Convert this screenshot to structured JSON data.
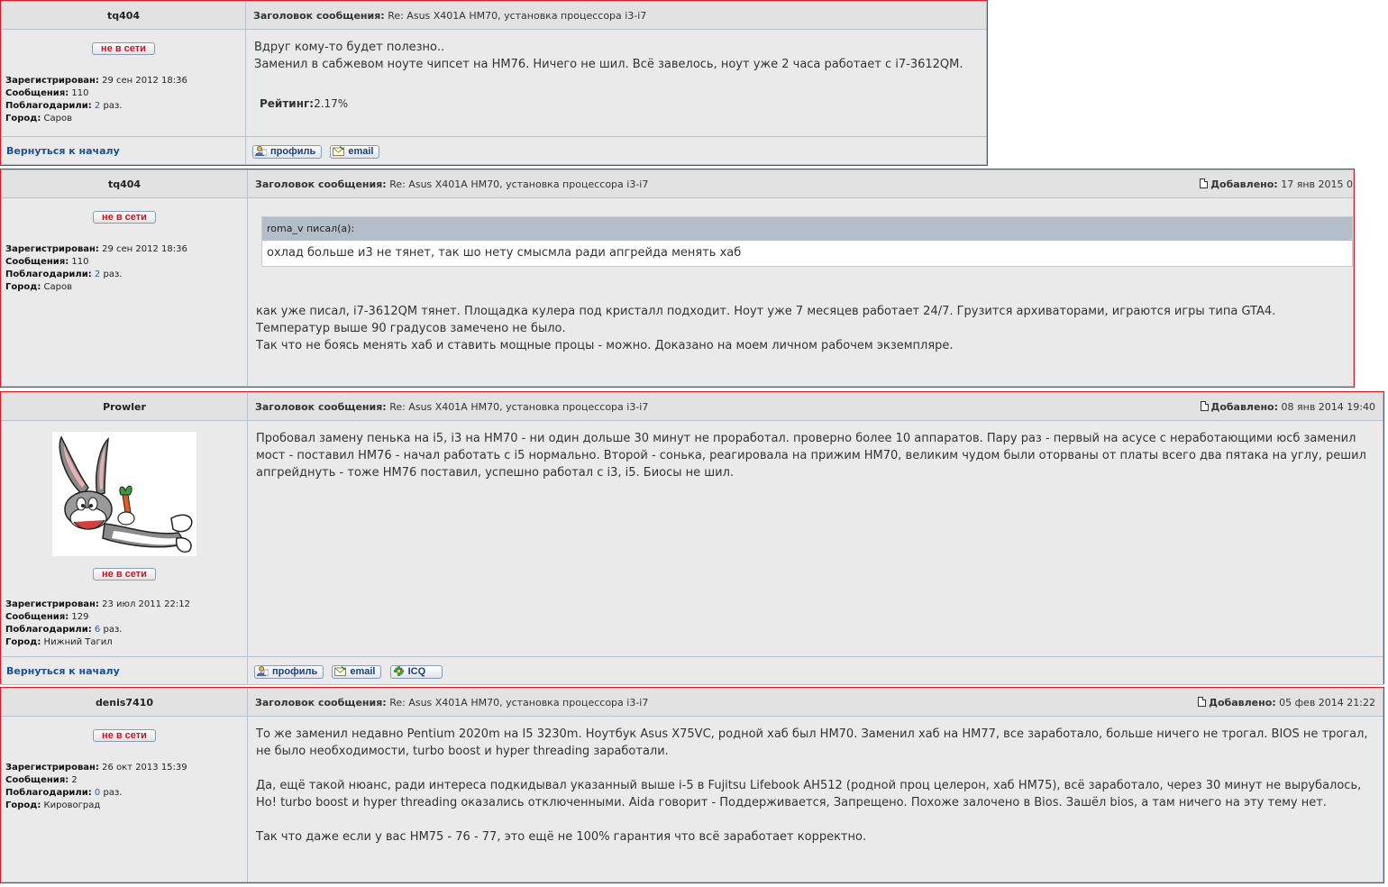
{
  "labels": {
    "subject": "Заголовок сообщения:",
    "added": "Добавлено:",
    "offline": "не в сети",
    "registered": "Зарегистрирован:",
    "messages": "Сообщения:",
    "thanked": "Поблагодарили:",
    "times": "раз.",
    "city": "Город:",
    "rating": "Рейтинг:",
    "back_to_top": "Вернуться к началу",
    "profile_btn": "профиль",
    "email_btn": "email",
    "icq_btn": "ICQ",
    "quote_wrote": "roma_v писал(а):"
  },
  "posts": [
    {
      "author": "tq404",
      "subject": "Re: Asus X401A HM70, установка процессора i3-i7",
      "registered": "29 сен 2012 18:36",
      "messages": "110",
      "thanked": "2",
      "city": "Саров",
      "body": [
        "Вдруг кому-то будет полезно..",
        "Заменил в сабжевом ноуте чипсет на HM76. Ничего не шил. Всё завелось, ноут уже 2 часа работает с i7-3612QM."
      ],
      "rating": "2.17%"
    },
    {
      "author": "tq404",
      "subject": "Re: Asus X401A HM70, установка процессора i3-i7",
      "added": "17 янв 2015 0",
      "registered": "29 сен 2012 18:36",
      "messages": "110",
      "thanked": "2",
      "city": "Саров",
      "quote": "охлад больше и3 не тянет, так шо нету смысмла ради апгрейда менять хаб",
      "body": [
        "как уже писал, i7-3612QM тянет. Площадка кулера под кристалл подходит. Ноут уже 7 месяцев работает 24/7. Грузится архиваторами, играются игры типа GTA4. Температур выше 90 градусов замечено не было.",
        "Так что не боясь менять хаб и ставить мощные процы - можно. Доказано на моем личном рабочем экземпляре."
      ]
    },
    {
      "author": "Prowler",
      "subject": "Re: Asus X401A HM70, установка процессора i3-i7",
      "added": "08 янв 2014 19:40",
      "registered": "23 июл 2011 22:12",
      "messages": "129",
      "thanked": "6",
      "city": "Нижний Тагил",
      "body": [
        "Пробовал замену пенька на i5, i3 на HM70 - ни один дольше 30 минут не проработал. проверно более 10 аппаратов. Пару раз - первый на асусе с неработающими юсб заменил мост - поставил HM76 - начал работать с i5 нормально. Второй - сонька, реагировала на прижим HM70, великим чудом были оторваны от платы всего два пятака на углу, решил апгрейднуть - тоже HM76 поставил, успешно работал с i3, i5. Биосы не шил."
      ]
    },
    {
      "author": "denis7410",
      "subject": "Re: Asus X401A HM70, установка процессора i3-i7",
      "added": "05 фев 2014 21:22",
      "registered": "26 окт 2013 15:39",
      "messages": "2",
      "thanked": "0",
      "city": "Кировоград",
      "body": [
        "То же заменил недавно Pentium 2020m на I5 3230m. Ноутбук Asus X75VC, родной хаб был HM70. Заменил хаб на HM77, все заработало, больше ничего не трогал. BIOS не трогал, не было необходимости, turbo boost и hyper threading заработали.",
        "Да, ещё такой нюанс, ради интереса подкидывал указанный выше i-5 в Fujitsu Lifebook AH512 (родной проц целерон, хаб HM75), всё заработало, через 30 минут не вырубалось, Но! turbo boost и hyper threading оказались отключенными. Aida говорит - Поддерживается, Запрещено. Похоже залочено в Bios. Зашёл bios, а там ничего на эту тему нет.",
        "Так что даже если у вас HM75 - 76 - 77, это ещё не 100% гарантия что всё заработает корректно."
      ]
    }
  ]
}
